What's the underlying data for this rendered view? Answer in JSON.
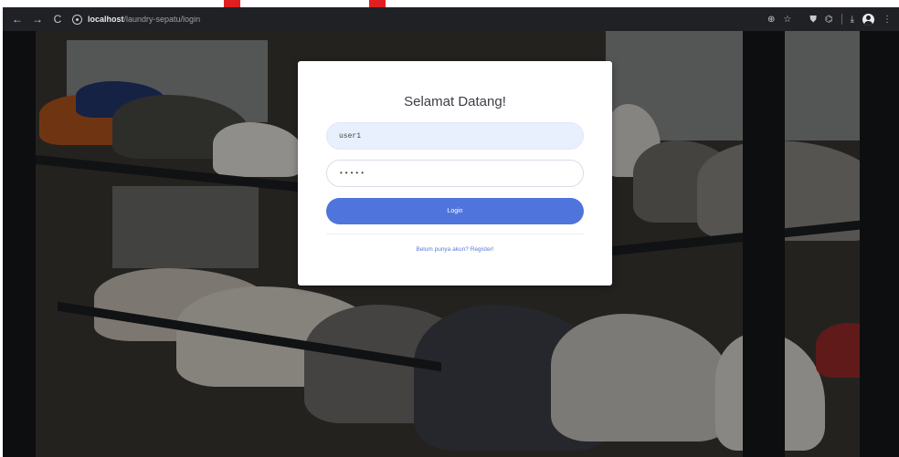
{
  "browser": {
    "nav": {
      "back_icon": "←",
      "forward_icon": "→",
      "reload_icon": "C"
    },
    "url_host": "localhost",
    "url_path": "/laundry-sepatu/login",
    "toolbar_icons": {
      "key_icon": "⊕",
      "star_icon": "☆",
      "shield_icon": "⛊",
      "extensions_icon": "⌬",
      "download_icon": "⤓",
      "menu_icon": "⋮"
    }
  },
  "login": {
    "title": "Selamat Datang!",
    "username_value": "user1",
    "password_value": "•••••",
    "login_label": "Login",
    "register_link": "Belum punya akun? Register!"
  },
  "colors": {
    "primary": "#4f74db",
    "autofill": "#e8f0fe",
    "chrome": "#202124",
    "accent_mark": "#e02020"
  }
}
